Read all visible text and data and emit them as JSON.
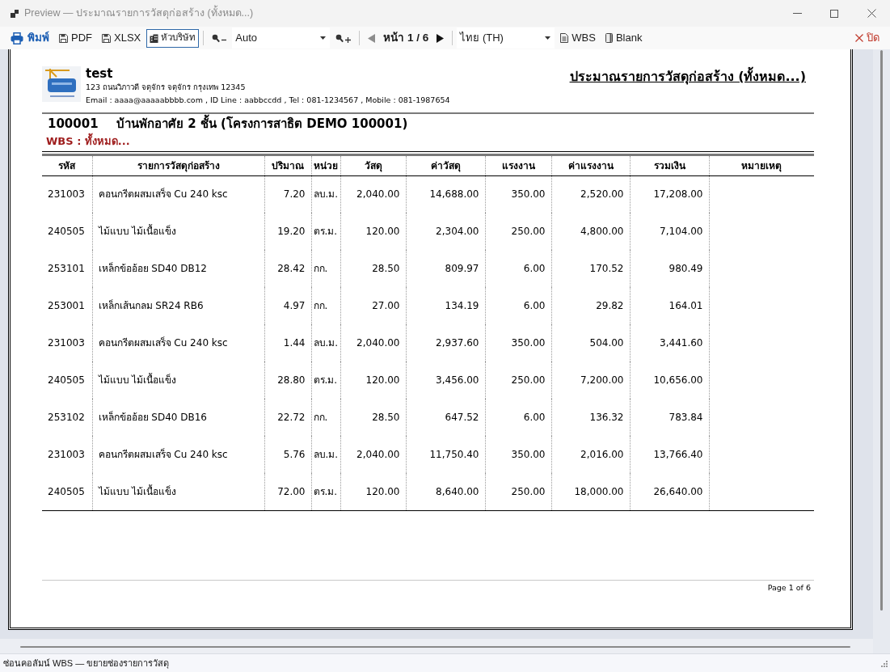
{
  "window": {
    "title": "Preview — ประมาณรายการวัสดุก่อสร้าง (ทั้งหมด...)"
  },
  "toolbar": {
    "groups": [
      [
        {
          "kind": "print",
          "label": "พิมพ์"
        },
        {
          "kind": "export",
          "label": "PDF"
        },
        {
          "kind": "export",
          "label": "XLSX"
        },
        {
          "kind": "toggle",
          "label": "หัวบริษัท",
          "on": true
        }
      ],
      [
        {
          "kind": "zoom_out"
        },
        {
          "kind": "zoom_select",
          "value": "Auto"
        },
        {
          "kind": "zoom_in"
        }
      ],
      [
        {
          "kind": "prev",
          "disabled": true
        },
        {
          "kind": "page",
          "label": "หน้า 1 / 6"
        },
        {
          "kind": "next",
          "disabled": false
        }
      ],
      [
        {
          "kind": "language_select",
          "value": "ไทย (TH)"
        },
        {
          "kind": "wbs",
          "label": "WBS"
        },
        {
          "kind": "blank",
          "label": "Blank"
        }
      ]
    ],
    "close": {
      "label": "ปิด"
    }
  },
  "report": {
    "company": {
      "name": "test",
      "address": "123 ถนนวิภาวดี จตุจักร จตุจักร กรุงเทพ 12345",
      "contact": "Email : aaaa@aaaaabbbb.com , ID Line : aabbccdd , Tel : 081-1234567 , Mobile : 081-1987654"
    },
    "title": "ประมาณรายการวัสดุก่อสร้าง (ทั้งหมด...)",
    "project": {
      "code": "100001",
      "name": "บ้านพักอาศัย 2 ชั้น (โครงการสาธิต DEMO 100001)"
    },
    "wbs": "WBS : ทั้งหมด...",
    "table": {
      "columns": [
        "รหัส",
        "รายการวัสดุก่อสร้าง",
        "ปริมาณ",
        "หน่วย",
        "วัสดุ",
        "ค่าวัสดุ",
        "แรงงาน",
        "ค่าแรงงาน",
        "รวมเงิน",
        "หมายเหตุ"
      ],
      "rows": [
        [
          "231003",
          "คอนกรีตผสมเสร็จ Cu 240 ksc",
          "7.20",
          "ลบ.ม.",
          "2,040.00",
          "14,688.00",
          "350.00",
          "2,520.00",
          "17,208.00"
        ],
        [
          "240505",
          "ไม้แบบ ไม้เนื้อแข็ง",
          "19.20",
          "ตร.ม.",
          "120.00",
          "2,304.00",
          "250.00",
          "4,800.00",
          "7,104.00"
        ],
        [
          "253101",
          "เหล็กข้ออ้อย SD40 DB12",
          "28.42",
          "กก.",
          "28.50",
          "809.97",
          "6.00",
          "170.52",
          "980.49"
        ],
        [
          "253001",
          "เหล็กเส้นกลม SR24 RB6",
          "4.97",
          "กก.",
          "27.00",
          "134.19",
          "6.00",
          "29.82",
          "164.01"
        ],
        [
          "231003",
          "คอนกรีตผสมเสร็จ Cu 240 ksc",
          "1.44",
          "ลบ.ม.",
          "2,040.00",
          "2,937.60",
          "350.00",
          "504.00",
          "3,441.60"
        ],
        [
          "240505",
          "ไม้แบบ ไม้เนื้อแข็ง",
          "28.80",
          "ตร.ม.",
          "120.00",
          "3,456.00",
          "250.00",
          "7,200.00",
          "10,656.00"
        ],
        [
          "253102",
          "เหล็กข้ออ้อย SD40 DB16",
          "22.72",
          "กก.",
          "28.50",
          "647.52",
          "6.00",
          "136.32",
          "783.84"
        ],
        [
          "231003",
          "คอนกรีตผสมเสร็จ Cu 240 ksc",
          "5.76",
          "ลบ.ม.",
          "2,040.00",
          "11,750.40",
          "350.00",
          "2,016.00",
          "13,766.40"
        ],
        [
          "240505",
          "ไม้แบบ ไม้เนื้อแข็ง",
          "72.00",
          "ตร.ม.",
          "120.00",
          "8,640.00",
          "250.00",
          "18,000.00",
          "26,640.00"
        ]
      ]
    },
    "footer": {
      "page": "Page 1 of 6"
    }
  },
  "status_bar": {
    "text": "ซ่อนคอลัมน์ WBS — ขยายช่องรายการวัสดุ"
  }
}
